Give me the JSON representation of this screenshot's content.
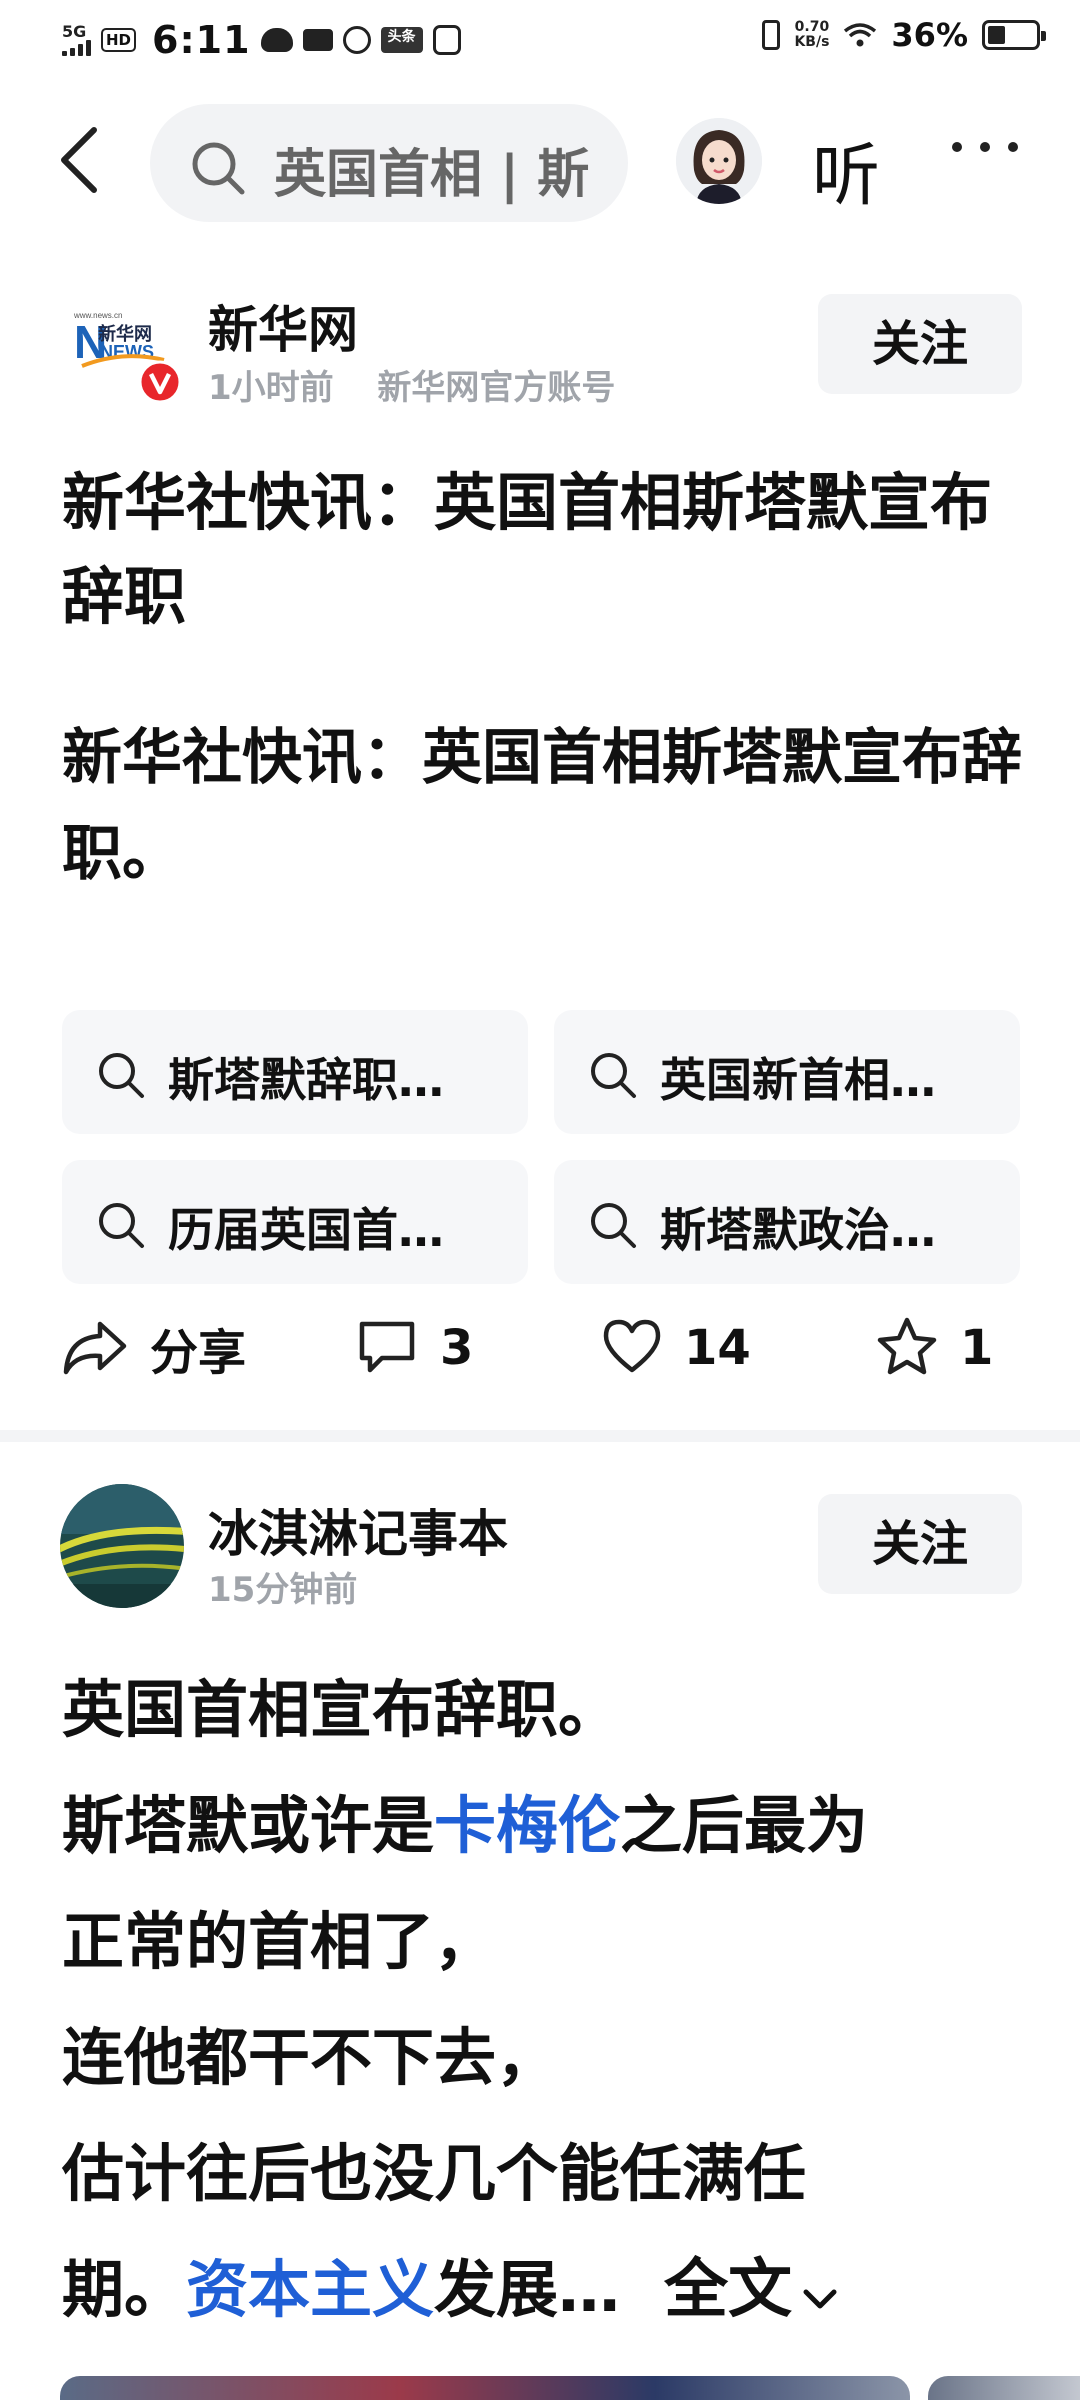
{
  "status_bar": {
    "network": "5G",
    "hd": "HD",
    "time": "6:11",
    "toutiao_badge": "头条",
    "speed_value": "0.70",
    "speed_unit": "KB/s",
    "battery_percent": "36%",
    "battery_level": 0.36
  },
  "nav": {
    "search_text": "英国首相 | 斯",
    "listen_label": "听"
  },
  "post1": {
    "author": "新华网",
    "time": "1小时前",
    "account": "新华网官方账号",
    "follow_label": "关注",
    "title": "新华社快讯：英国首相斯塔默宣布辞职",
    "body": "新华社快讯：英国首相斯塔默宣布辞职。",
    "chips": [
      {
        "label": "斯塔默辞职…"
      },
      {
        "label": "英国新首相…"
      },
      {
        "label": "历届英国首…"
      },
      {
        "label": "斯塔默政治…"
      }
    ],
    "actions": {
      "share_label": "分享",
      "comments": "3",
      "likes": "14",
      "favorites": "1"
    },
    "logo_text": "新华网",
    "logo_news": "NEWS"
  },
  "post2": {
    "author": "冰淇淋记事本",
    "time": "15分钟前",
    "follow_label": "关注",
    "line1": "英国首相宣布辞职。",
    "line2_a": "斯塔默或许是",
    "line2_link": "卡梅伦",
    "line2_b": "之后最为",
    "line3": "正常的首相了，",
    "line4": "连他都干不下去，",
    "line5": "估计往后也没几个能任满任",
    "line6_a": "期。",
    "line6_link": "资本主义",
    "line6_b": "发展…",
    "fulltext_label": "全文"
  }
}
